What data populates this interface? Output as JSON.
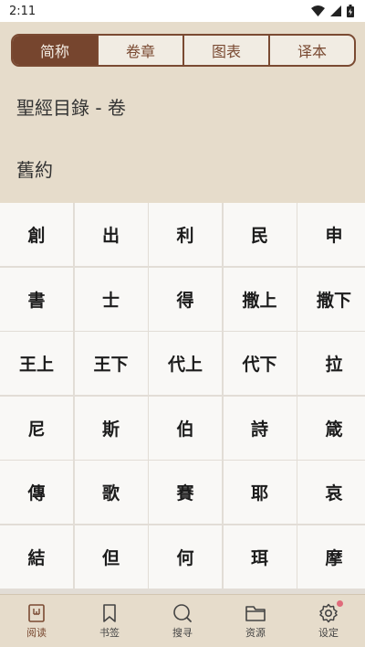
{
  "status_bar": {
    "time": "2:11"
  },
  "tabs": [
    {
      "label": "简称",
      "selected": true
    },
    {
      "label": "卷章",
      "selected": false
    },
    {
      "label": "图表",
      "selected": false
    },
    {
      "label": "译本",
      "selected": false
    }
  ],
  "header": {
    "title": "聖經目錄 - 卷",
    "section": "舊約"
  },
  "books": [
    "創",
    "出",
    "利",
    "民",
    "申",
    "書",
    "士",
    "得",
    "撒上",
    "撒下",
    "王上",
    "王下",
    "代上",
    "代下",
    "拉",
    "尼",
    "斯",
    "伯",
    "詩",
    "箴",
    "傳",
    "歌",
    "賽",
    "耶",
    "哀",
    "結",
    "但",
    "何",
    "珥",
    "摩"
  ],
  "bottom_nav": [
    {
      "label": "阅读",
      "icon": "read-icon",
      "active": true
    },
    {
      "label": "书签",
      "icon": "bookmark-icon",
      "active": false
    },
    {
      "label": "搜寻",
      "icon": "search-icon",
      "active": false
    },
    {
      "label": "资源",
      "icon": "folder-icon",
      "active": false
    },
    {
      "label": "设定",
      "icon": "gear-icon",
      "active": false,
      "badge": true
    }
  ],
  "colors": {
    "accent": "#76452e",
    "background": "#e6dccb",
    "badge": "#e06b7b"
  }
}
